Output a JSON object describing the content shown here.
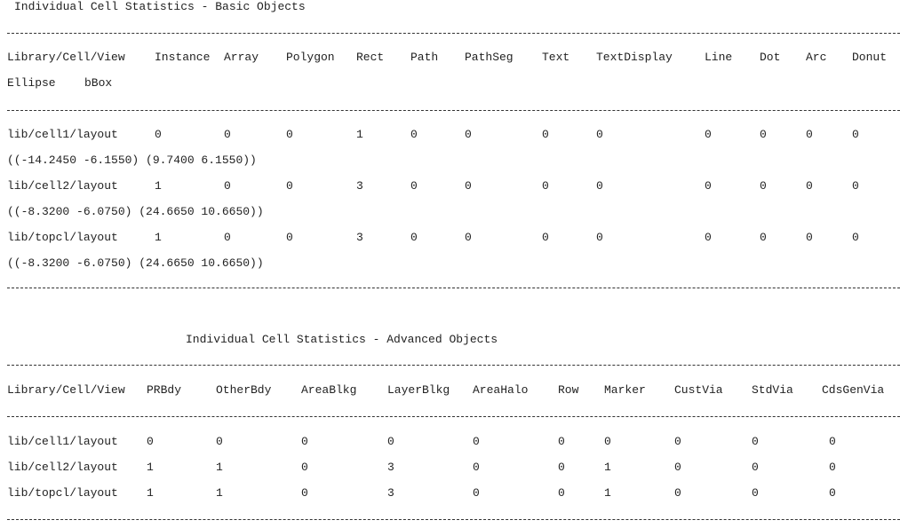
{
  "basic": {
    "title": "Individual Cell Statistics - Basic Objects",
    "headers": [
      "Library/Cell/View",
      "Instance",
      "Array",
      "Polygon",
      "Rect",
      "Path",
      "PathSeg",
      "Text",
      "TextDisplay",
      "Line",
      "Dot",
      "Arc",
      "Donut"
    ],
    "headers2": [
      "Ellipse",
      "bBox"
    ],
    "rows": [
      {
        "cells": [
          "lib/cell1/layout",
          "0",
          "0",
          "0",
          "1",
          "0",
          "0",
          "0",
          "0",
          "0",
          "0",
          "0",
          "0"
        ],
        "bbox": "((-14.2450 -6.1550) (9.7400 6.1550))"
      },
      {
        "cells": [
          "lib/cell2/layout",
          "1",
          "0",
          "0",
          "3",
          "0",
          "0",
          "0",
          "0",
          "0",
          "0",
          "0",
          "0"
        ],
        "bbox": "((-8.3200 -6.0750) (24.6650 10.6650))"
      },
      {
        "cells": [
          "lib/topcl/layout",
          "1",
          "0",
          "0",
          "3",
          "0",
          "0",
          "0",
          "0",
          "0",
          "0",
          "0",
          "0"
        ],
        "bbox": "((-8.3200 -6.0750) (24.6650 10.6650))"
      }
    ]
  },
  "advanced": {
    "title": "Individual Cell Statistics - Advanced Objects",
    "headers": [
      "Library/Cell/View",
      "PRBdy",
      "OtherBdy",
      "AreaBlkg",
      "LayerBlkg",
      "AreaHalo",
      "Row",
      "Marker",
      "CustVia",
      "StdVia",
      "CdsGenVia"
    ],
    "rows": [
      [
        "lib/cell1/layout",
        "0",
        "0",
        "0",
        "0",
        "0",
        "0",
        "0",
        "0",
        "0",
        "0"
      ],
      [
        "lib/cell2/layout",
        "1",
        "1",
        "0",
        "3",
        "0",
        "0",
        "1",
        "0",
        "0",
        "0"
      ],
      [
        "lib/topcl/layout",
        "1",
        "1",
        "0",
        "3",
        "0",
        "0",
        "1",
        "0",
        "0",
        "0"
      ]
    ]
  }
}
